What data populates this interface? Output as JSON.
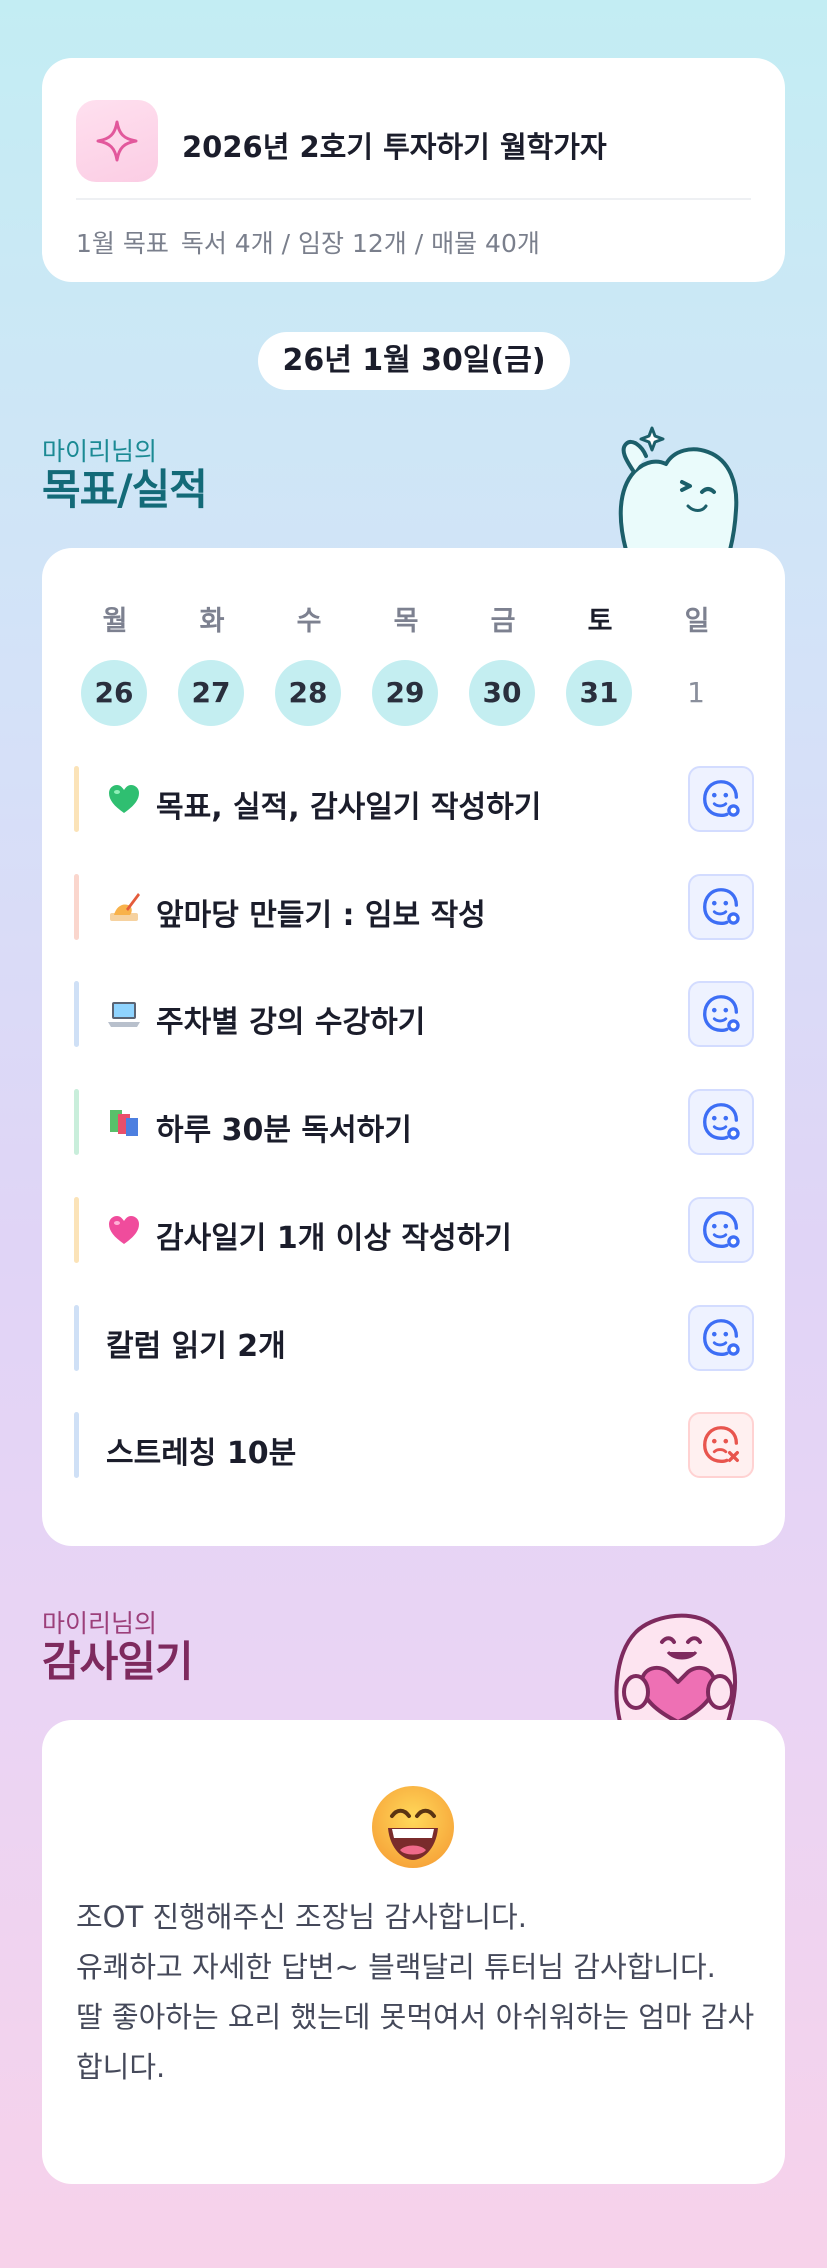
{
  "header": {
    "title": "2026년 2호기 투자하기 월학가자",
    "goal_label": "1월 목표",
    "goal_detail": "독서 4개 / 임장 12개 / 매물 40개",
    "icon": "sparkle-icon"
  },
  "date": "26년 1월 30일(금)",
  "goal_section": {
    "subtitle": "마이리님의",
    "title": "목표/실적"
  },
  "week": [
    {
      "day": "월",
      "num": "26",
      "active": true
    },
    {
      "day": "화",
      "num": "27",
      "active": true
    },
    {
      "day": "수",
      "num": "28",
      "active": true
    },
    {
      "day": "목",
      "num": "29",
      "active": true
    },
    {
      "day": "금",
      "num": "30",
      "active": true
    },
    {
      "day": "토",
      "num": "31",
      "active": true
    },
    {
      "day": "일",
      "num": "1",
      "active": false
    }
  ],
  "tasks": [
    {
      "label": "목표, 실적, 감사일기 작성하기",
      "emoji": "green-heart-icon",
      "bar_color": "#fbe3b8",
      "status": "done"
    },
    {
      "label": "앞마당 만들기 : 임보 작성",
      "emoji": "writing-hand-icon",
      "bar_color": "#fad6cd",
      "status": "done"
    },
    {
      "label": "주차별 강의 수강하기",
      "emoji": "laptop-icon",
      "bar_color": "#cfe0f6",
      "status": "done"
    },
    {
      "label": "하루 30분 독서하기",
      "emoji": "books-icon",
      "bar_color": "#c9eedb",
      "status": "done"
    },
    {
      "label": "감사일기 1개 이상 작성하기",
      "emoji": "pink-heart-icon",
      "bar_color": "#fbe3b8",
      "status": "done"
    },
    {
      "label": "칼럼 읽기 2개",
      "emoji": "",
      "bar_color": "#cfe0f6",
      "status": "done"
    },
    {
      "label": "스트레칭 10분",
      "emoji": "",
      "bar_color": "#cfe0f6",
      "status": "missed"
    }
  ],
  "gratitude_section": {
    "subtitle": "마이리님의",
    "title": "감사일기"
  },
  "gratitude": {
    "face": "grinning-face-icon",
    "lines": [
      "조OT 진행해주신 조장님 감사합니다.",
      "유쾌하고 자세한 답변~ 블랙달리 튜터님 감사합니다.",
      "딸 좋아하는 요리 했는데 못먹여서 아쉬워하는 엄마 감사합니다."
    ]
  },
  "colors": {
    "accent_teal": "#136a78",
    "accent_plum": "#7e2a5e",
    "done_blue": "#3d6ef5",
    "missed_red": "#e8554e"
  }
}
